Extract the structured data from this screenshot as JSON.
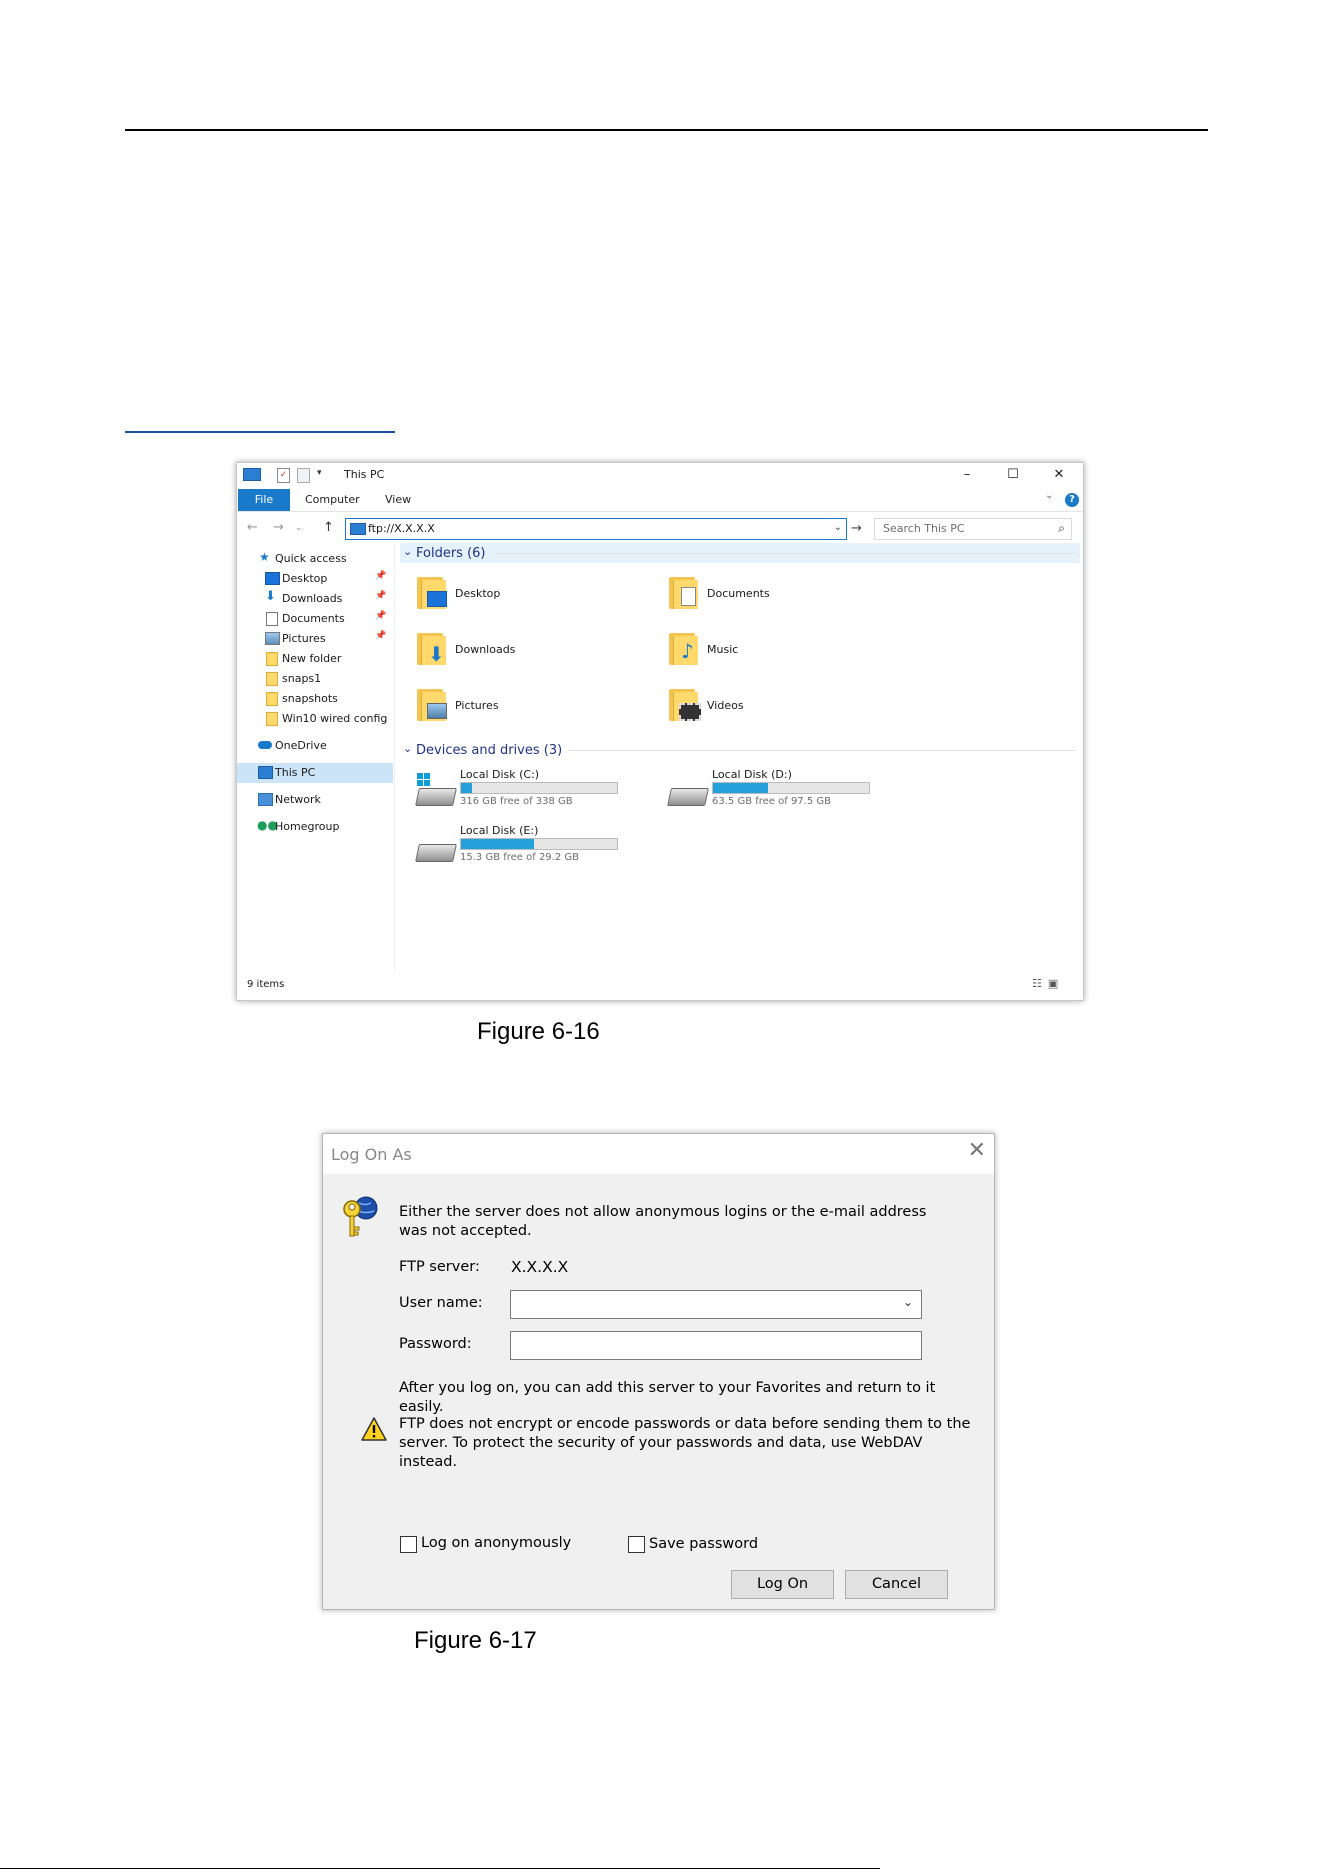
{
  "explorer": {
    "title": "This PC",
    "window_controls": {
      "minimize": "–",
      "maximize": "☐",
      "close": "✕"
    },
    "tabs": {
      "file": "File",
      "computer": "Computer",
      "view": "View"
    },
    "help": "?",
    "address": "ftp://X.X.X.X",
    "search_placeholder": "Search This PC",
    "sidebar": {
      "quick_access": "Quick access",
      "desktop": "Desktop",
      "downloads": "Downloads",
      "documents": "Documents",
      "pictures": "Pictures",
      "new_folder": "New folder",
      "snaps1": "snaps1",
      "snapshots": "snapshots",
      "win10": "Win10 wired config",
      "onedrive": "OneDrive",
      "this_pc": "This PC",
      "network": "Network",
      "homegroup": "Homegroup"
    },
    "folders_header": "Folders (6)",
    "folders": {
      "desktop": "Desktop",
      "documents": "Documents",
      "downloads": "Downloads",
      "music": "Music",
      "pictures": "Pictures",
      "videos": "Videos"
    },
    "devices_header": "Devices and drives (3)",
    "drives": {
      "c": {
        "name": "Local Disk (C:)",
        "free": "316 GB free of 338 GB",
        "used_fraction": 0.07
      },
      "d": {
        "name": "Local Disk (D:)",
        "free": "63.5 GB free of 97.5 GB",
        "used_fraction": 0.35
      },
      "e": {
        "name": "Local Disk (E:)",
        "free": "15.3 GB free of 29.2 GB",
        "used_fraction": 0.47
      }
    },
    "status": "9 items",
    "colors": {
      "accent": "#1979ca",
      "folder": "#ffd96b",
      "bar": "#26a0da"
    }
  },
  "caption1": "Figure 6-16",
  "dialog": {
    "title": "Log On As",
    "close": "✕",
    "message": "Either the server does not allow anonymous logins or the e-mail address was not accepted.",
    "ftp_server_label": "FTP server:",
    "ftp_server_value": "X.X.X.X",
    "user_name_label": "User name:",
    "password_label": "Password:",
    "after_text": "After you log on, you can add this server to your Favorites and return to it easily.",
    "warning": "FTP does not encrypt or encode passwords or data before sending them to the server.  To protect the security of your passwords and data, use WebDAV instead.",
    "log_on_anonymously": "Log on anonymously",
    "save_password": "Save password",
    "log_on_button": "Log On",
    "cancel_button": "Cancel"
  },
  "caption2": "Figure 6-17"
}
